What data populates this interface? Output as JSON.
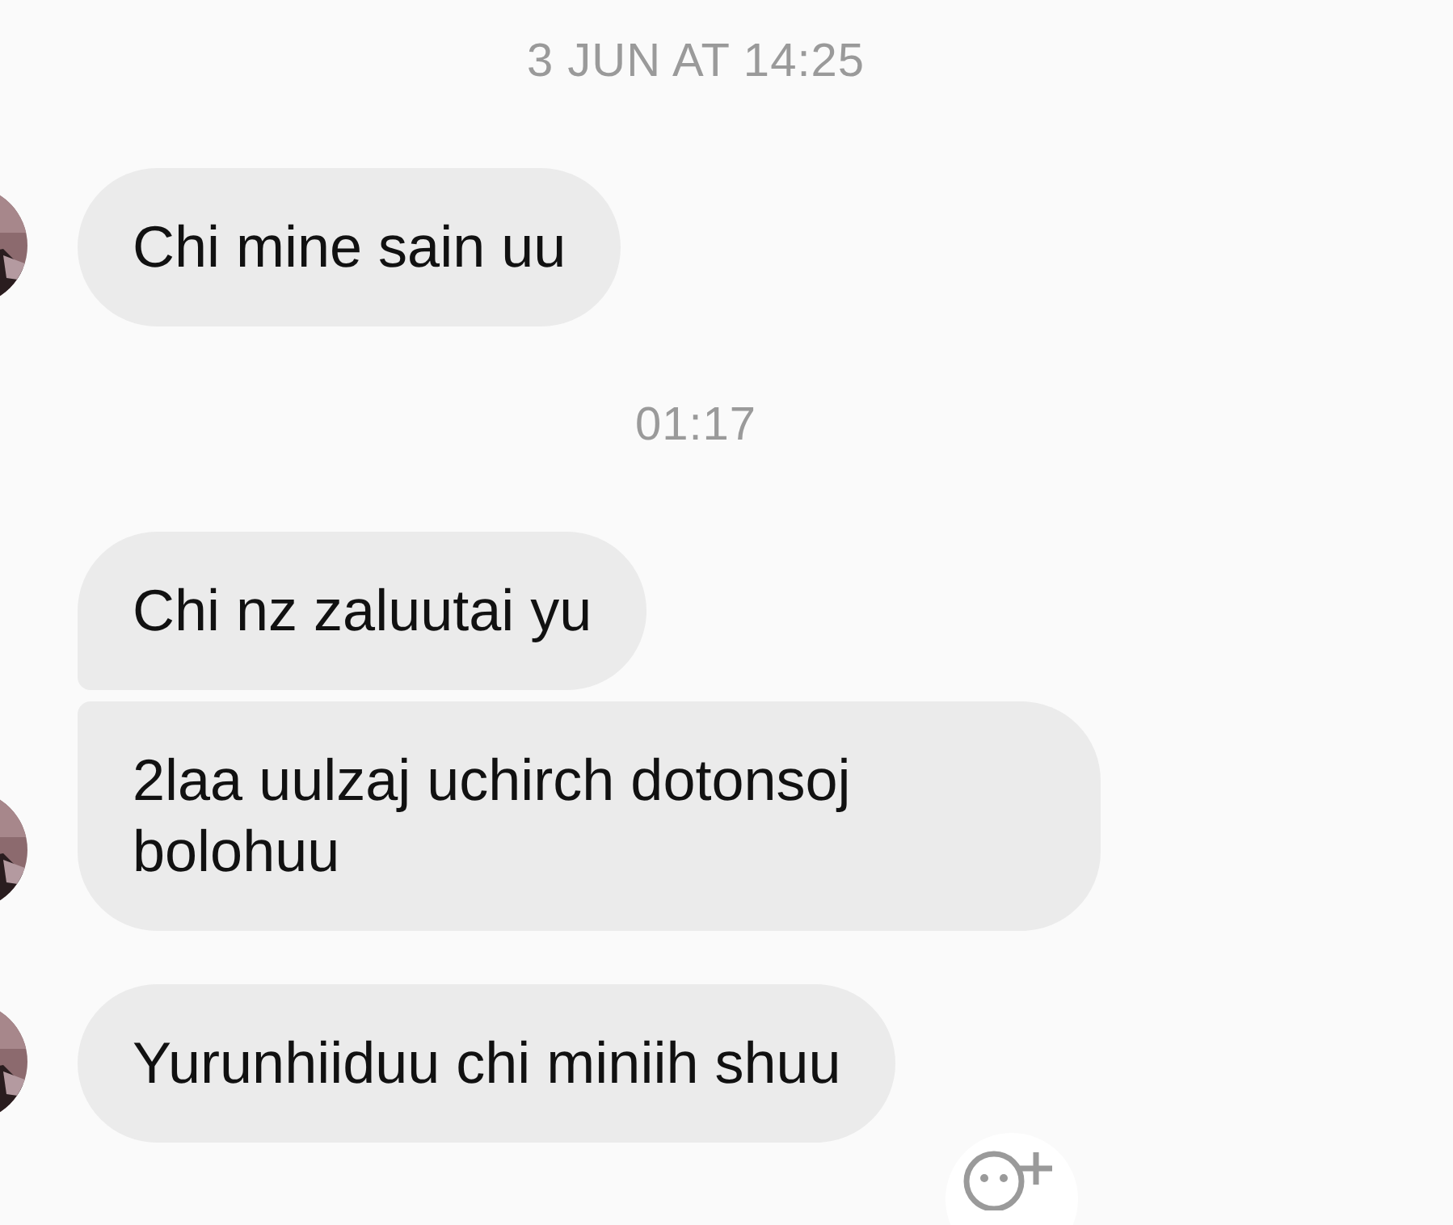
{
  "thread": [
    {
      "kind": "timestamp",
      "text": "3 JUN AT 14:25"
    },
    {
      "kind": "message",
      "text": "Chi mine sain uu",
      "joined_above": false,
      "joined_below": false,
      "avatar": true,
      "reaction_button": false
    },
    {
      "kind": "timestamp",
      "text": "01:17"
    },
    {
      "kind": "message",
      "text": "Chi nz zaluutai yu",
      "joined_above": false,
      "joined_below": true,
      "avatar": false,
      "reaction_button": false
    },
    {
      "kind": "message",
      "text": "2laa uulzaj uchirch dotonsoj bolohuu",
      "joined_above": true,
      "joined_below": false,
      "avatar": true,
      "reaction_button": false
    },
    {
      "kind": "message",
      "text": "Yurunhiiduu chi miniih shuu",
      "joined_above": false,
      "joined_below": false,
      "avatar": true,
      "reaction_button": true
    }
  ]
}
